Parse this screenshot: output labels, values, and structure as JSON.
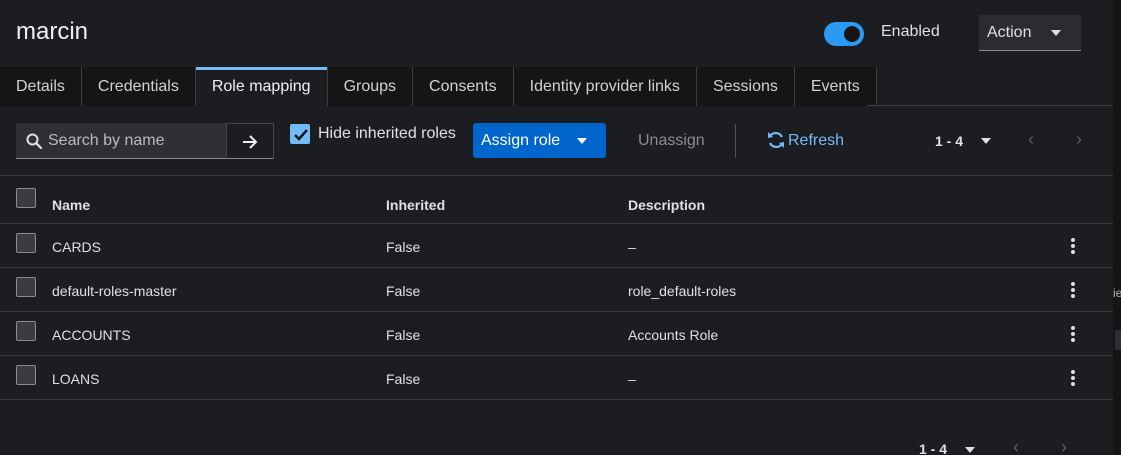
{
  "header": {
    "title": "marcin",
    "enabled_label": "Enabled",
    "enabled": true,
    "action_label": "Action"
  },
  "tabs": [
    {
      "label": "Details",
      "active": false
    },
    {
      "label": "Credentials",
      "active": false
    },
    {
      "label": "Role mapping",
      "active": true
    },
    {
      "label": "Groups",
      "active": false
    },
    {
      "label": "Consents",
      "active": false
    },
    {
      "label": "Identity provider links",
      "active": false
    },
    {
      "label": "Sessions",
      "active": false
    },
    {
      "label": "Events",
      "active": false
    }
  ],
  "toolbar": {
    "search_placeholder": "Search by name",
    "hide_inherited_label": "Hide inherited roles",
    "hide_inherited_checked": true,
    "assign_label": "Assign role",
    "unassign_label": "Unassign",
    "refresh_label": "Refresh",
    "pagination_range": "1 - 4"
  },
  "table": {
    "columns": [
      "Name",
      "Inherited",
      "Description"
    ],
    "rows": [
      {
        "name": "CARDS",
        "inherited": "False",
        "description": "–"
      },
      {
        "name": "default-roles-master",
        "inherited": "False",
        "description": "role_default-roles"
      },
      {
        "name": "ACCOUNTS",
        "inherited": "False",
        "description": "Accounts Role"
      },
      {
        "name": "LOANS",
        "inherited": "False",
        "description": "–"
      }
    ]
  },
  "footer": {
    "pagination_range": "1 - 4"
  },
  "edge_glyph": "ie",
  "colors": {
    "accent": "#2b9af3",
    "primary_button": "#0066cc",
    "link": "#73bcf7",
    "background": "#1b1d21"
  }
}
